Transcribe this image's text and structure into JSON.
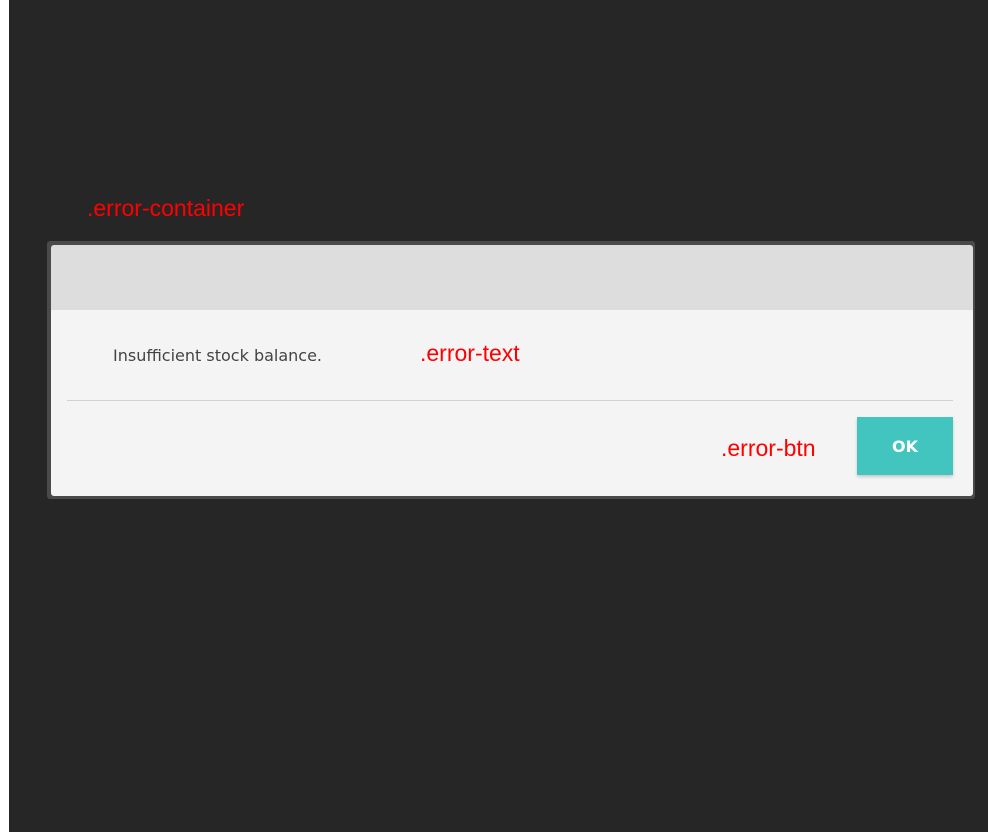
{
  "annotations": {
    "container": ".error-container",
    "text": ".error-text",
    "button": ".error-btn"
  },
  "dialog": {
    "message": "Insufficient stock balance.",
    "ok_label": "OK"
  },
  "colors": {
    "page_background": "#262626",
    "annotation": "#ff0000",
    "header": "#dddddd",
    "body": "#f4f4f4",
    "button": "#42c4bf"
  }
}
